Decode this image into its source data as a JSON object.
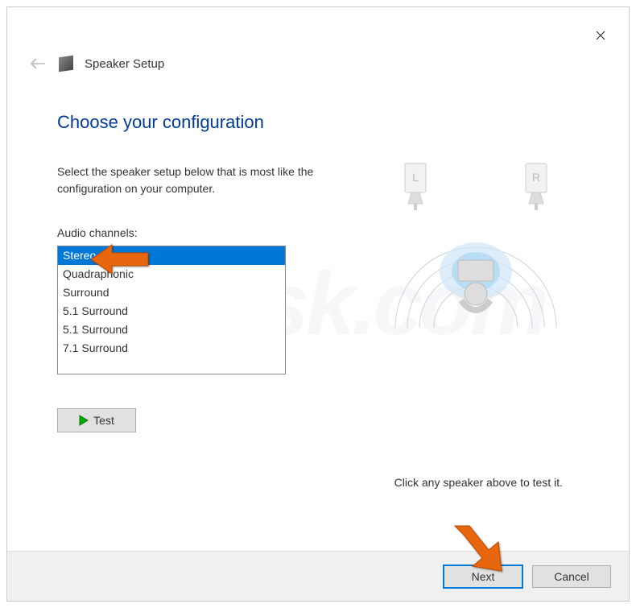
{
  "window": {
    "title": "Speaker Setup"
  },
  "page": {
    "heading": "Choose your configuration",
    "description": "Select the speaker setup below that is most like the configuration on your computer.",
    "channels_label": "Audio channels:",
    "test_btn": "Test",
    "hint": "Click any speaker above to test it."
  },
  "channels": [
    {
      "label": "Stereo",
      "selected": true
    },
    {
      "label": "Quadraphonic",
      "selected": false
    },
    {
      "label": "Surround",
      "selected": false
    },
    {
      "label": "5.1 Surround",
      "selected": false
    },
    {
      "label": "5.1 Surround",
      "selected": false
    },
    {
      "label": "7.1 Surround",
      "selected": false
    }
  ],
  "diagram": {
    "left_speaker": "L",
    "right_speaker": "R"
  },
  "footer": {
    "next": "Next",
    "cancel": "Cancel"
  },
  "watermark": "PCrisk.com"
}
